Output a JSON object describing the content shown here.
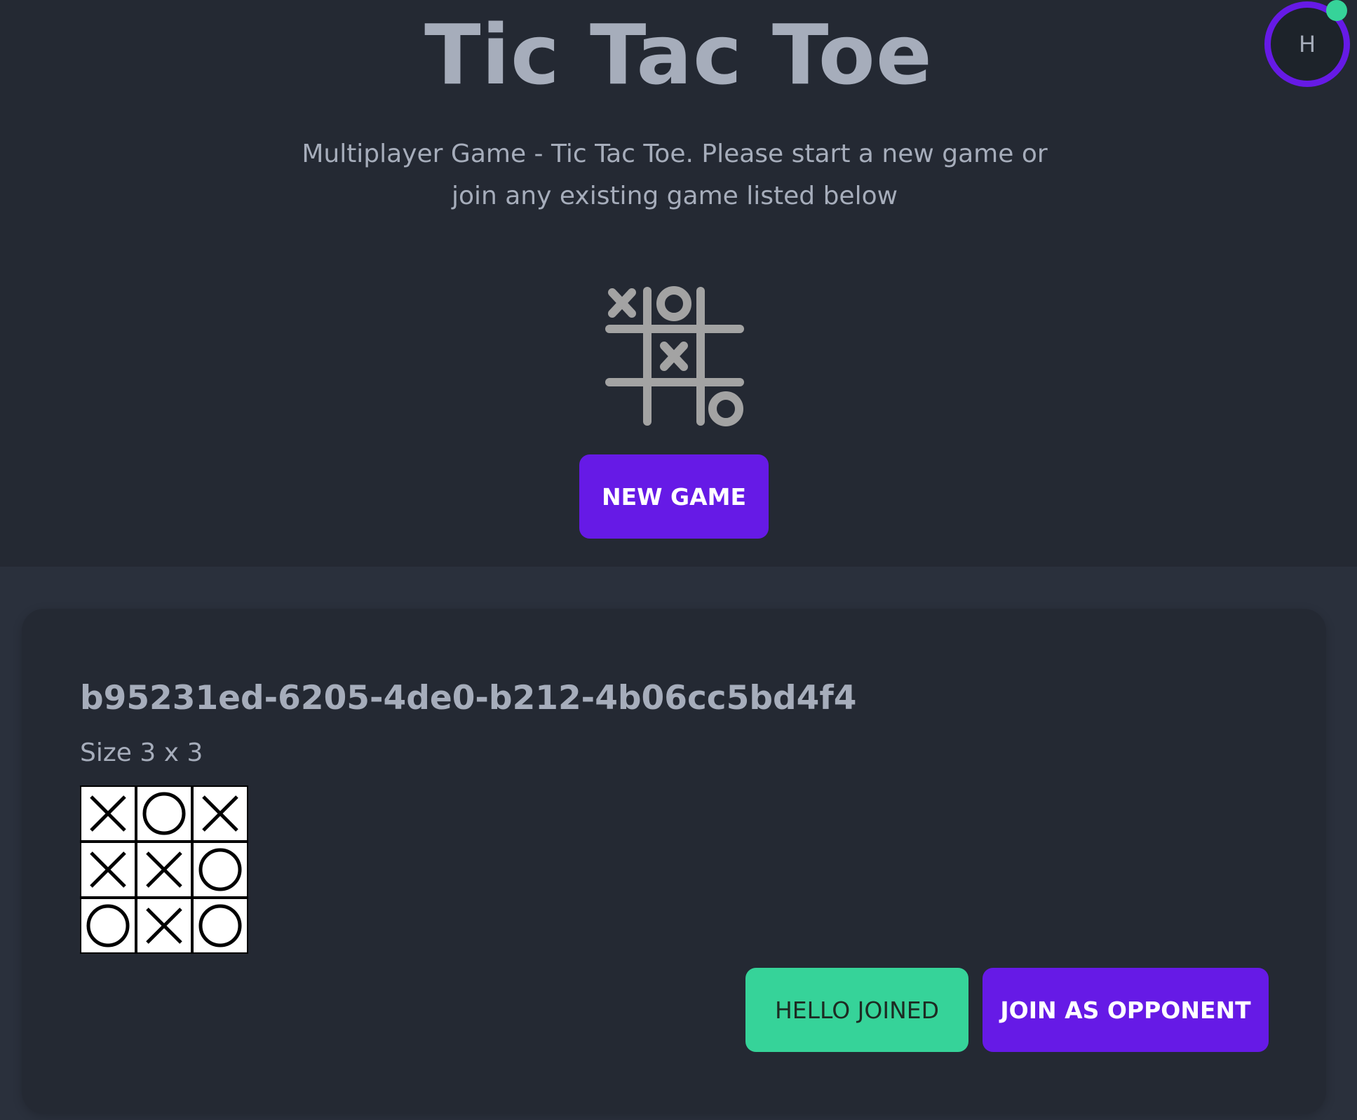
{
  "header": {
    "title": "Tic Tac Toe",
    "subtitle": "Multiplayer Game - Tic Tac Toe. Please start a new game or join any existing game listed below",
    "hero_icon": "tic-tac-toe-icon",
    "new_game_label": "NEW GAME"
  },
  "user": {
    "avatar_initial": "H",
    "online": true
  },
  "games": [
    {
      "id": "b95231ed-6205-4de0-b212-4b06cc5bd4f4",
      "size_label": "Size 3 x 3",
      "board": [
        "X",
        "O",
        "X",
        "X",
        "X",
        "O",
        "O",
        "X",
        "O"
      ],
      "joined_label": "HELLO JOINED",
      "join_label": "JOIN AS OPPONENT"
    }
  ],
  "colors": {
    "primary": "#661ae6",
    "success": "#36d399",
    "base_100": "#2a303c",
    "base_200": "#242933",
    "text": "#a6adbb",
    "icon_gray": "#a3a3a3"
  }
}
